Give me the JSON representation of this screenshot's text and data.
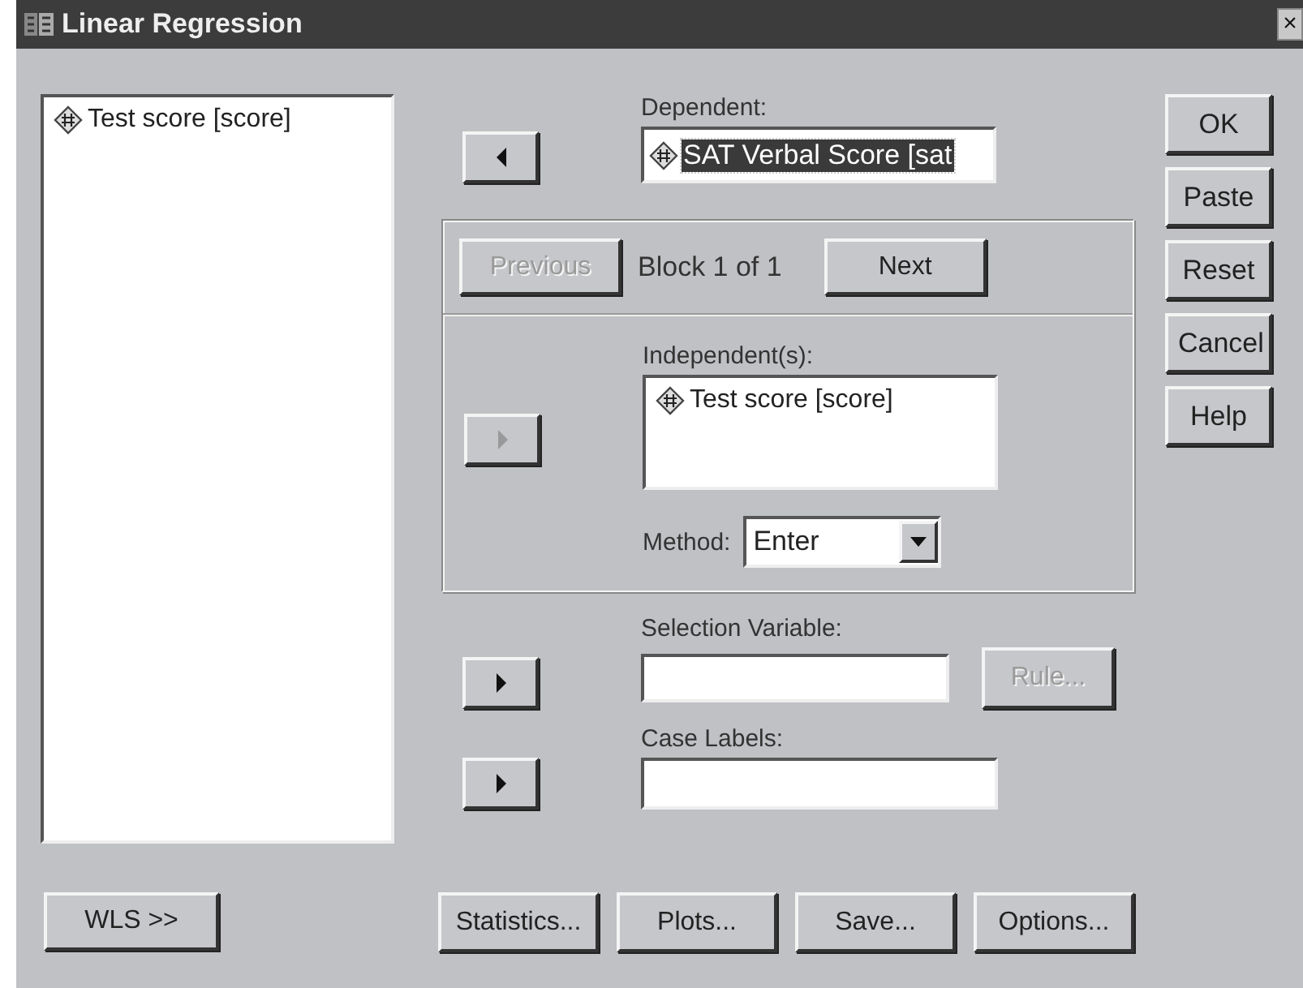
{
  "window": {
    "title": "Linear Regression",
    "close": "×"
  },
  "variables": [
    {
      "label": "Test score [score]",
      "selected": false
    }
  ],
  "dependent": {
    "label": "Dependent:",
    "arrow": {
      "kind": "left",
      "disabled": false
    },
    "value": "SAT Verbal Score [sat",
    "selected": true
  },
  "block": {
    "previous": {
      "label": "Previous",
      "disabled": true
    },
    "status": "Block 1 of 1",
    "next": {
      "label": "Next",
      "disabled": false
    }
  },
  "independents": {
    "label": "Independent(s):",
    "arrow": {
      "kind": "right",
      "disabled": true
    },
    "items": [
      {
        "label": "Test score [score]",
        "selected": false
      }
    ]
  },
  "method": {
    "label": "Method:",
    "value": "Enter"
  },
  "selection_variable": {
    "label": "Selection Variable:",
    "arrow": {
      "kind": "right",
      "disabled": false
    },
    "rule": {
      "label": "Rule...",
      "disabled": true
    }
  },
  "case_labels": {
    "label": "Case Labels:",
    "arrow": {
      "kind": "right",
      "disabled": false
    }
  },
  "side_buttons": [
    {
      "label": "OK",
      "disabled": false
    },
    {
      "label": "Paste",
      "disabled": false
    },
    {
      "label": "Reset",
      "disabled": false
    },
    {
      "label": "Cancel",
      "disabled": false
    },
    {
      "label": "Help",
      "disabled": false
    }
  ],
  "wls_button": {
    "label": "WLS >>",
    "disabled": false
  },
  "bottom_buttons": [
    {
      "label": "Statistics...",
      "disabled": false
    },
    {
      "label": "Plots...",
      "disabled": false
    },
    {
      "label": "Save...",
      "disabled": false
    },
    {
      "label": "Options...",
      "disabled": false
    }
  ]
}
